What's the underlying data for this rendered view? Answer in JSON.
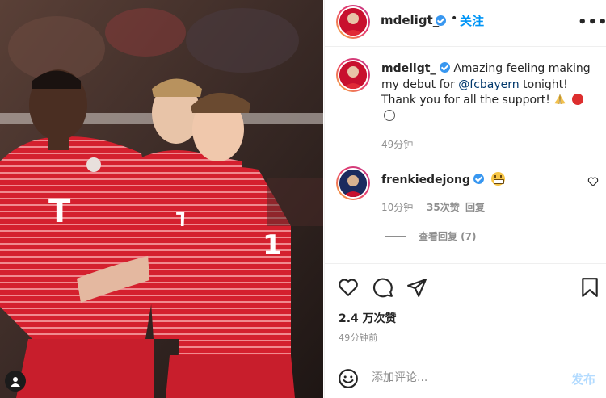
{
  "post_author": {
    "username": "mdeligt_",
    "verified": true,
    "follow_label": "关注",
    "separator": "•",
    "more_icon": "more-horizontal-icon"
  },
  "caption": {
    "username": "mdeligt_",
    "text_before_mention": "Amazing feeling making my debut for ",
    "mention": "@fcbayern",
    "text_after_mention": " tonight! Thank you for all the support!",
    "emojis": [
      "folded-hands",
      "red-circle",
      "white-circle"
    ],
    "time": "49分钟"
  },
  "comment": {
    "username": "frenkiedejong",
    "verified": true,
    "emoji": "grinning-face",
    "time": "10分钟",
    "likes": "35次赞",
    "reply_label": "回复",
    "view_replies_label": "查看回复 (7)"
  },
  "actions": {
    "icons": [
      "heart-icon",
      "comment-icon",
      "share-icon",
      "bookmark-icon"
    ],
    "likes_text": "2.4 万次赞",
    "post_time": "49分钟前"
  },
  "comment_box": {
    "placeholder": "添加评论...",
    "post_label": "发布"
  },
  "colors": {
    "accent": "#0095f6",
    "verified": "#3897f0",
    "secondary_text": "#8e8e8e",
    "post_disabled": "#b3dbff",
    "bayern_red": "#c8102e"
  }
}
